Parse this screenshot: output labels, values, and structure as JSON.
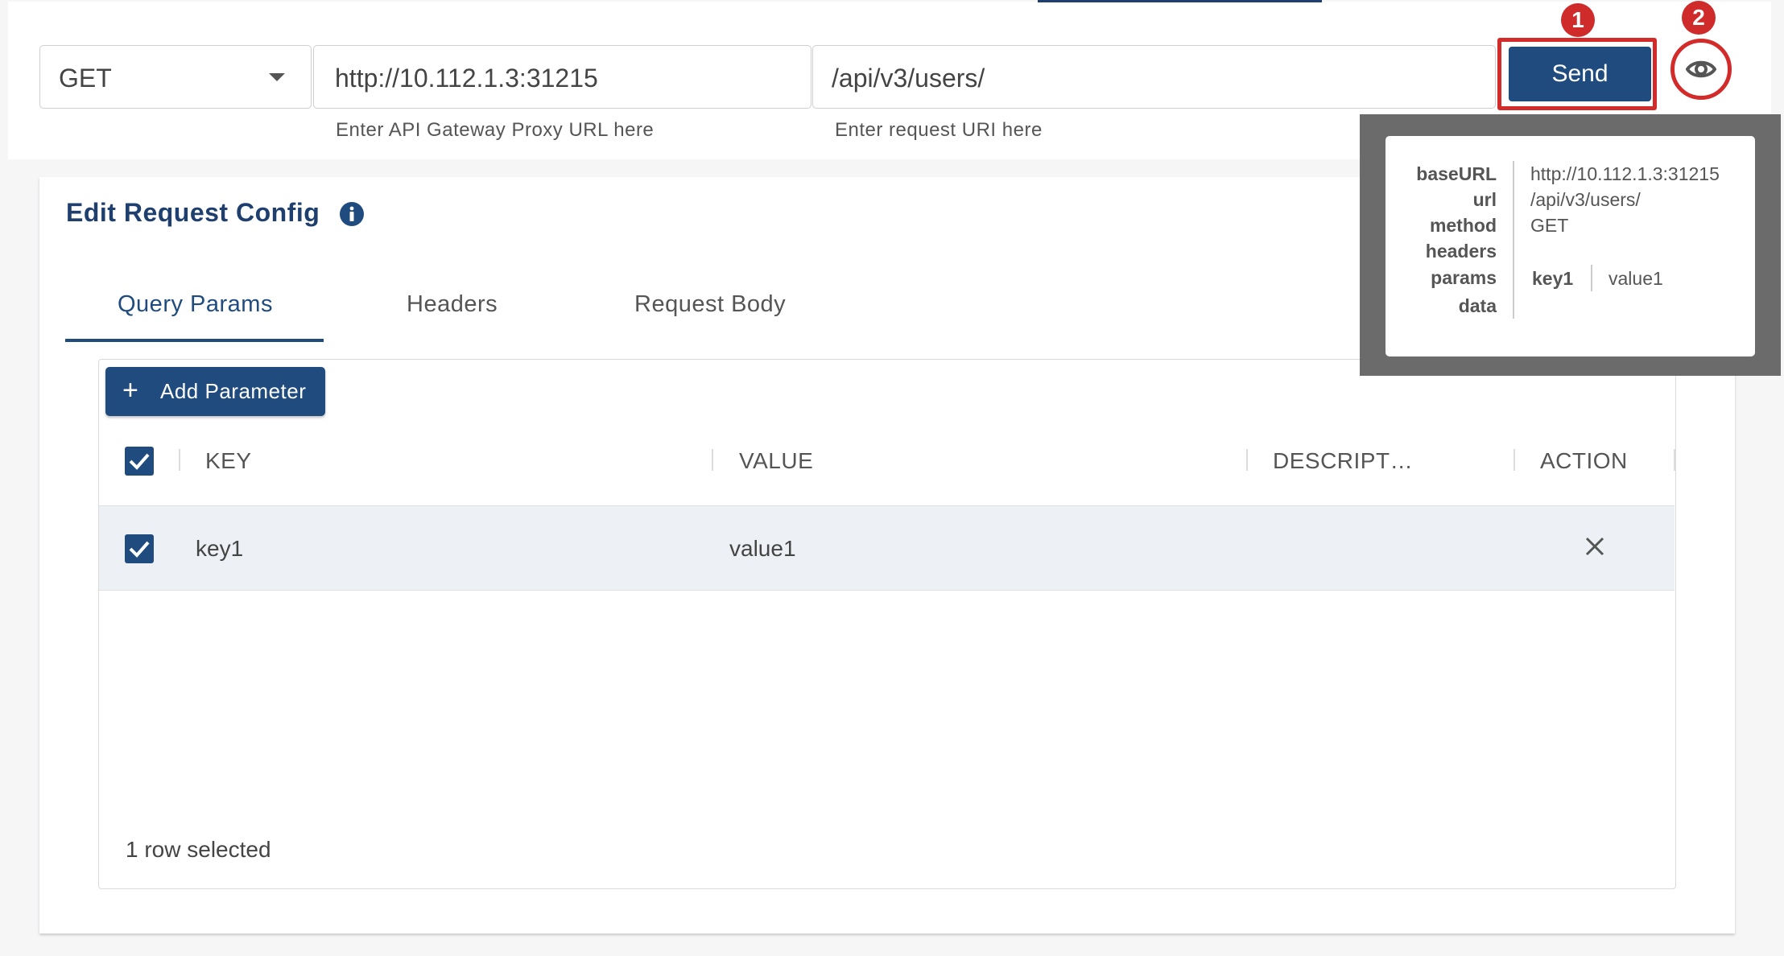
{
  "request": {
    "method": "GET",
    "base_url": "http://10.112.1.3:31215",
    "base_url_helper": "Enter API Gateway Proxy URL here",
    "uri": "/api/v3/users/",
    "uri_helper": "Enter request URI here",
    "send_label": "Send"
  },
  "annotations": {
    "badge1": "1",
    "badge2": "2"
  },
  "config": {
    "title": "Edit Request Config",
    "tabs": [
      "Query Params",
      "Headers",
      "Request Body"
    ],
    "add_button": "Add Parameter",
    "columns": [
      "KEY",
      "VALUE",
      "DESCRIPT…",
      "ACTION"
    ],
    "rows": [
      {
        "key": "key1",
        "value": "value1",
        "description": ""
      }
    ],
    "footer": "1 row selected"
  },
  "preview": {
    "labels": {
      "baseURL": "baseURL",
      "url": "url",
      "method": "method",
      "headers": "headers",
      "params": "params",
      "data": "data"
    },
    "values": {
      "baseURL": "http://10.112.1.3:31215",
      "url": "/api/v3/users/",
      "method": "GET",
      "param_key": "key1",
      "param_value": "value1"
    }
  },
  "colors": {
    "primary": "#1f4b7f",
    "title": "#1f3f6e",
    "annotation_red": "#d32a2a"
  },
  "icons": {
    "method_dropdown": "chevron-down-icon",
    "preview": "eye-icon",
    "info": "info-icon",
    "add": "plus-icon",
    "delete": "close-icon",
    "checkbox": "check-icon"
  }
}
